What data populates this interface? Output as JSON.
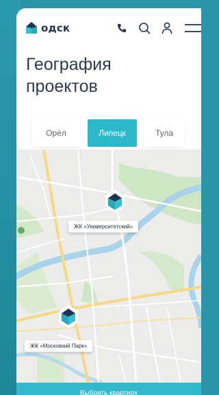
{
  "header": {
    "logo_text": "одск",
    "icons": [
      "phone-icon",
      "search-icon",
      "user-icon",
      "menu-icon"
    ]
  },
  "page": {
    "title_line1": "География",
    "title_line2": "проектов"
  },
  "tabs": [
    {
      "label": "Орёл",
      "active": false
    },
    {
      "label": "Липецк",
      "active": true
    },
    {
      "label": "Тула",
      "active": false
    }
  ],
  "map": {
    "markers": [
      {
        "label": "ЖК «Университетский»"
      },
      {
        "label": "ЖК «Московкий Парк»"
      }
    ]
  },
  "cta": {
    "label": "Выбрать квартиру"
  },
  "colors": {
    "accent": "#2cb8c9",
    "brand_dark": "#1d3350",
    "background": "#2a95a8"
  }
}
